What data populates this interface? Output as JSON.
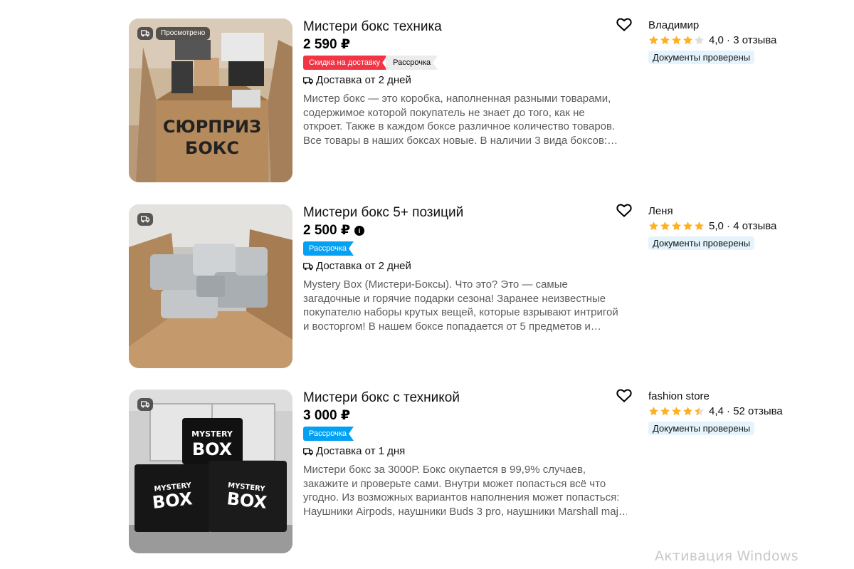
{
  "listings": [
    {
      "title": "Мистери бокс техника",
      "price": "2 590 ₽",
      "price_info_icon": false,
      "photo_badge": "Просмотрено",
      "photo_box_text": [
        "СЮРПРИЗ",
        "БОКС"
      ],
      "tags": [
        {
          "label": "Скидка на доставку",
          "style": "red"
        },
        {
          "label": "Рассрочка",
          "style": "grey"
        }
      ],
      "delivery": "Доставка от 2 дней",
      "description": [
        "Мистер бокс — это коробка, наполненная разными товарами,",
        "содержимое которой покупатель не знает до того, как не",
        "откроет. Также в каждом боксе различное количество товаров.",
        "Все товары в наших боксах новые. В наличии 3 вида боксов:…"
      ],
      "seller": {
        "name": "Владимир",
        "rating": "4,0",
        "stars": 4.0,
        "reviews": "3 отзыва",
        "verified": "Документы проверены"
      }
    },
    {
      "title": "Мистери бокс 5+ позиций",
      "price": "2 500 ₽",
      "price_info_icon": true,
      "photo_badge": "",
      "tags": [
        {
          "label": "Рассрочка",
          "style": "blue"
        }
      ],
      "delivery": "Доставка от 2 дней",
      "description": [
        "Mystery Box (Мистери-Боксы). Что это? Это — самые",
        "загадочные и горячие подарки сезона! Заранее неизвестные",
        "покупателю наборы крутых вещей, которые взрывают интригой",
        "и восторгом! В нашем боксе попадается от 5 предметов и…"
      ],
      "seller": {
        "name": "Леня",
        "rating": "5,0",
        "stars": 5.0,
        "reviews": "4 отзыва",
        "verified": "Документы проверены"
      }
    },
    {
      "title": "Мистери бокс с техникой",
      "price": "3 000 ₽",
      "price_info_icon": false,
      "photo_badge": "",
      "photo_box_text": [
        "MYSTERY",
        "BOX"
      ],
      "tags": [
        {
          "label": "Рассрочка",
          "style": "blue"
        }
      ],
      "delivery": "Доставка от 1 дня",
      "description": [
        "Мистери бокс за 3000Р. Бокс окупается в 99,9% случаев,",
        "закажите и проверьте сами. Внутри может попасться всё что",
        "угодно. Из возможных вариантов наполнения может попасться:",
        "Наушники Airpods, наушники Buds 3 pro, наушники Marshall maj…"
      ],
      "seller": {
        "name": "fashion store",
        "rating": "4,4",
        "stars": 4.4,
        "reviews": "52 отзыва",
        "verified": "Документы проверены"
      }
    }
  ],
  "icons": {
    "favorite": "heart-outline-icon",
    "delivery": "delivery-truck-icon",
    "star": "star-icon",
    "price_info": "info-circle-icon"
  },
  "colors": {
    "star": "#ffb021",
    "star_empty": "#dedede",
    "tag_red": "#f23545",
    "tag_blue": "#04a1f3",
    "verified_bg": "#e4f3fc"
  },
  "watermark": "Активация Windows"
}
